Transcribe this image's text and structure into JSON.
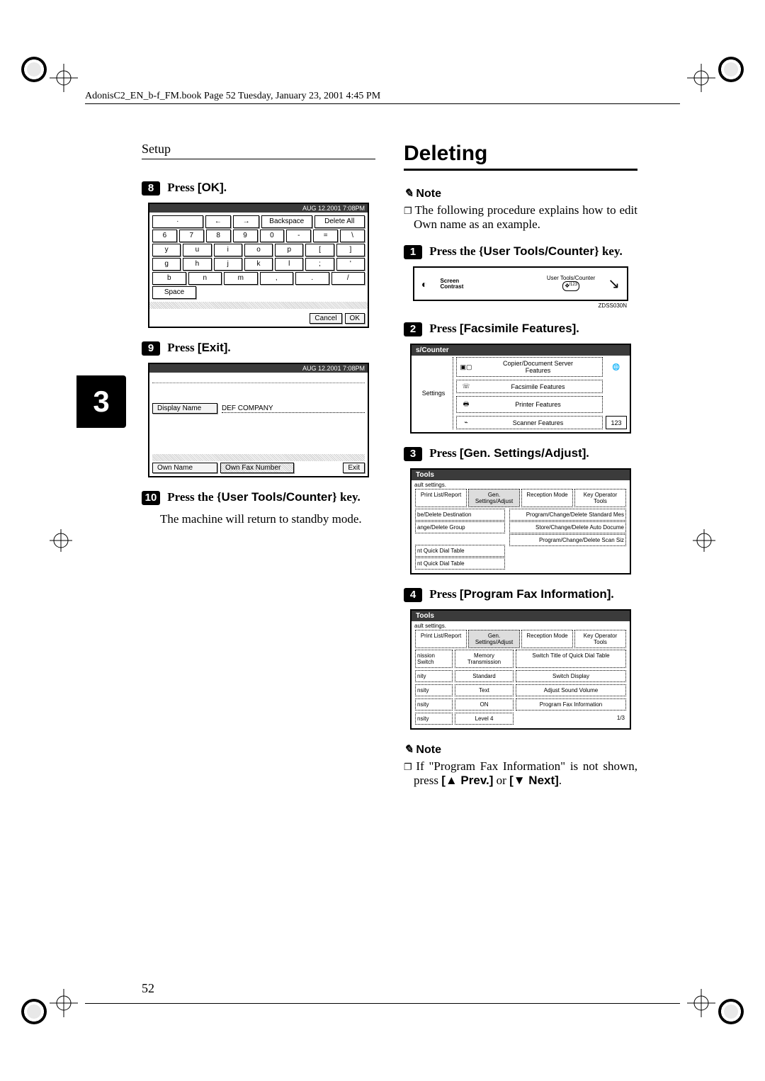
{
  "book_header": "AdonisC2_EN_b-f_FM.book  Page 52  Tuesday, January 23, 2001  4:45 PM",
  "section_header": "Setup",
  "page_number": "52",
  "tab_number": "3",
  "left": {
    "step8": {
      "num": "8",
      "text_a": "Press ",
      "label": "[OK]",
      "text_b": "."
    },
    "fig8": {
      "date": "AUG   12.2001  7:08PM",
      "top_keys": [
        "←",
        "→",
        "Backspace",
        "Delete All"
      ],
      "row1": [
        "6",
        "7",
        "8",
        "9",
        "0",
        "-",
        "=",
        "\\"
      ],
      "row2": [
        "y",
        "u",
        "i",
        "o",
        "p",
        "[",
        "]"
      ],
      "row3": [
        "g",
        "h",
        "j",
        "k",
        "l",
        ";",
        "'"
      ],
      "row4": [
        "b",
        "n",
        "m",
        ",",
        ".",
        "/"
      ],
      "space": "Space",
      "cancel": "Cancel",
      "ok": "OK"
    },
    "step9": {
      "num": "9",
      "text_a": "Press ",
      "label": "[Exit]",
      "text_b": "."
    },
    "fig9": {
      "date": "AUG   12.2001  7:08PM",
      "display_name_label": "Display Name",
      "display_name_value": "DEF COMPANY",
      "own_name": "Own Name",
      "own_fax": "Own Fax Number",
      "exit": "Exit"
    },
    "step10": {
      "num": "10",
      "text_a": "Press the ",
      "key_left": "{",
      "key_label": "User Tools/Counter",
      "key_right": "}",
      "text_b": " key."
    },
    "standby": "The machine will return to standby mode."
  },
  "right": {
    "title": "Deleting",
    "note1_label": "Note",
    "note1_body": "The following procedure explains how to edit Own name as an example.",
    "step1": {
      "num": "1",
      "text_a": "Press the ",
      "key_left": "{",
      "key_label": "User Tools/Counter",
      "key_right": "}",
      "text_b": " key."
    },
    "fig1": {
      "screen_contrast": "Screen\nContrast",
      "ut": "User  Tools/Counter",
      "ref": "ZDSS030N"
    },
    "step2": {
      "num": "2",
      "text_a": "Press ",
      "label": "[Facsimile Features]",
      "text_b": "."
    },
    "fig2": {
      "header": "s/Counter",
      "side": "Settings",
      "items": [
        "Copier/Document Server\nFeatures",
        "Facsimile Features",
        "Printer Features",
        "Scanner Features"
      ],
      "counter": "123"
    },
    "step3": {
      "num": "3",
      "text_a": "Press ",
      "label": "[Gen. Settings/Adjust]",
      "text_b": "."
    },
    "fig3": {
      "header": "Tools",
      "sub": "ault settings.",
      "tabs": [
        "Print List/Report",
        "Gen. Settings/Adjust",
        "Reception Mode",
        "Key Operator Tools"
      ],
      "left_items": [
        "be/Delete Destination",
        "ange/Delete Group",
        "",
        "nt Quick Dial Table",
        "nt Quick Dial Table"
      ],
      "right_items": [
        "Program/Change/Delete Standard Mes",
        "Store/Change/Delete Auto Docume",
        "Program/Change/Delete Scan Siz"
      ]
    },
    "step4": {
      "num": "4",
      "text_a": "Press ",
      "label": "[Program Fax Information]",
      "text_b": "."
    },
    "fig4": {
      "header": "Tools",
      "sub": "ault settings.",
      "tabs": [
        "Print List/Report",
        "Gen. Settings/Adjust",
        "Reception Mode",
        "Key Operator Tools"
      ],
      "rows_l": [
        [
          "nission Switch",
          "Memory Transmission"
        ],
        [
          "nity",
          "Standard"
        ],
        [
          "nsity",
          "Text"
        ],
        [
          "nsity",
          "ON"
        ],
        [
          "nsity",
          "Level 4"
        ]
      ],
      "rows_r": [
        "Switch Title of Quick Dial Table",
        "Switch Display",
        "Adjust Sound Volume",
        "Program Fax Information",
        "1/3"
      ]
    },
    "note2_label": "Note",
    "note2_body_a": "If \"Program Fax Information\" is not shown, press ",
    "prev": "[▲ Prev.]",
    "or": " or ",
    "next": "[▼ Next]",
    "dot": "."
  }
}
